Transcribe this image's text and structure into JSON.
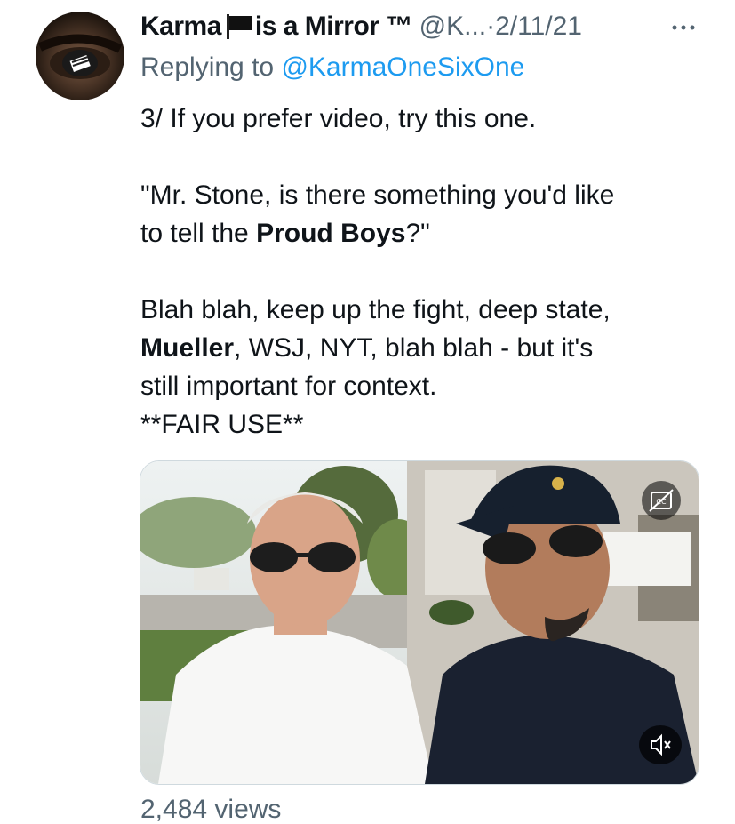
{
  "tweet": {
    "author_name_1": "Karma",
    "author_name_2": "is a Mirror",
    "trademark": "™",
    "handle": "@K...",
    "separator": "·",
    "date": "2/11/21",
    "reply_prefix": "Replying to ",
    "reply_mention": "@KarmaOneSixOne",
    "line1": "3/ If you prefer video, try this one.",
    "quote_line1": "\"Mr. Stone, is there something you'd like",
    "quote_line2_pre": "to tell the ",
    "quote_line2_bold": "Proud Boys",
    "quote_line2_post": "?\"",
    "para3_line1": "Blah blah, keep up the fight, deep state,",
    "para3_line2_bold": "Mueller",
    "para3_line2_post": ", WSJ, NYT, blah blah - but it's",
    "para3_line3": "still important for context.",
    "fair_use": "**FAIR USE**",
    "views_partial": "2,484 views"
  },
  "icons": {
    "flag": "black-flag-icon",
    "more": "more-horizontal-icon",
    "captions": "closed-captions-off-icon",
    "mute": "speaker-muted-icon"
  },
  "colors": {
    "text": "#0f1419",
    "secondary": "#536471",
    "link": "#1d9bf0"
  }
}
